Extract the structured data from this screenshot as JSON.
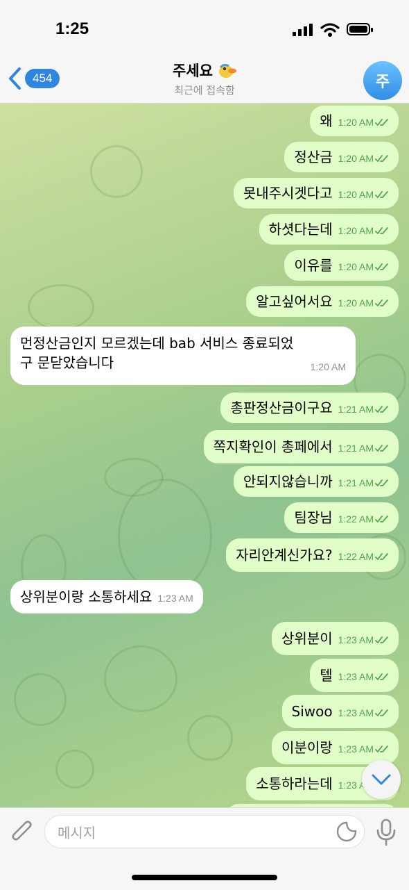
{
  "status": {
    "time": "1:25"
  },
  "header": {
    "back_count": "454",
    "title": "주세요",
    "subtitle": "최근에 접속함",
    "avatar_letter": "주"
  },
  "messages": [
    {
      "dir": "out",
      "text": "왜",
      "time": "1:20 AM"
    },
    {
      "dir": "out",
      "text": "정산금",
      "time": "1:20 AM"
    },
    {
      "dir": "out",
      "text": "못내주시겟다고",
      "time": "1:20 AM"
    },
    {
      "dir": "out",
      "text": "하셧다는데",
      "time": "1:20 AM"
    },
    {
      "dir": "out",
      "text": "이유를",
      "time": "1:20 AM"
    },
    {
      "dir": "out",
      "text": "알고싶어서요",
      "time": "1:20 AM"
    },
    {
      "dir": "in",
      "line1": "먼정산금인지 모르겠는데 bab 서비스 종료되었",
      "line2": "구 문닫았습니다",
      "time": "1:20 AM"
    },
    {
      "dir": "out",
      "text": "총판정산금이구요",
      "time": "1:21 AM"
    },
    {
      "dir": "out",
      "text": "쪽지확인이 총페에서",
      "time": "1:21 AM"
    },
    {
      "dir": "out",
      "text": "안되지않습니까",
      "time": "1:21 AM"
    },
    {
      "dir": "out",
      "text": "팀장님",
      "time": "1:22 AM"
    },
    {
      "dir": "out",
      "text": "자리안계신가요?",
      "time": "1:22 AM"
    },
    {
      "dir": "in",
      "text": "상위분이랑 소통하세요",
      "time": "1:23 AM"
    },
    {
      "dir": "out",
      "text": "상위분이",
      "time": "1:23 AM"
    },
    {
      "dir": "out",
      "text": "텔",
      "time": "1:23 AM"
    },
    {
      "dir": "out",
      "text": "Siwoo",
      "time": "1:23 AM"
    },
    {
      "dir": "out",
      "text": "이분이랑",
      "time": "1:23 AM"
    },
    {
      "dir": "out",
      "text": "소통하라는데",
      "time": "1:23 AM"
    }
  ],
  "composer": {
    "placeholder": "메시지"
  },
  "colors": {
    "outgoing_bubble": "#e2fec8",
    "incoming_bubble": "#ffffff",
    "accent": "#2f86e0",
    "read_check": "#4ea84a"
  }
}
